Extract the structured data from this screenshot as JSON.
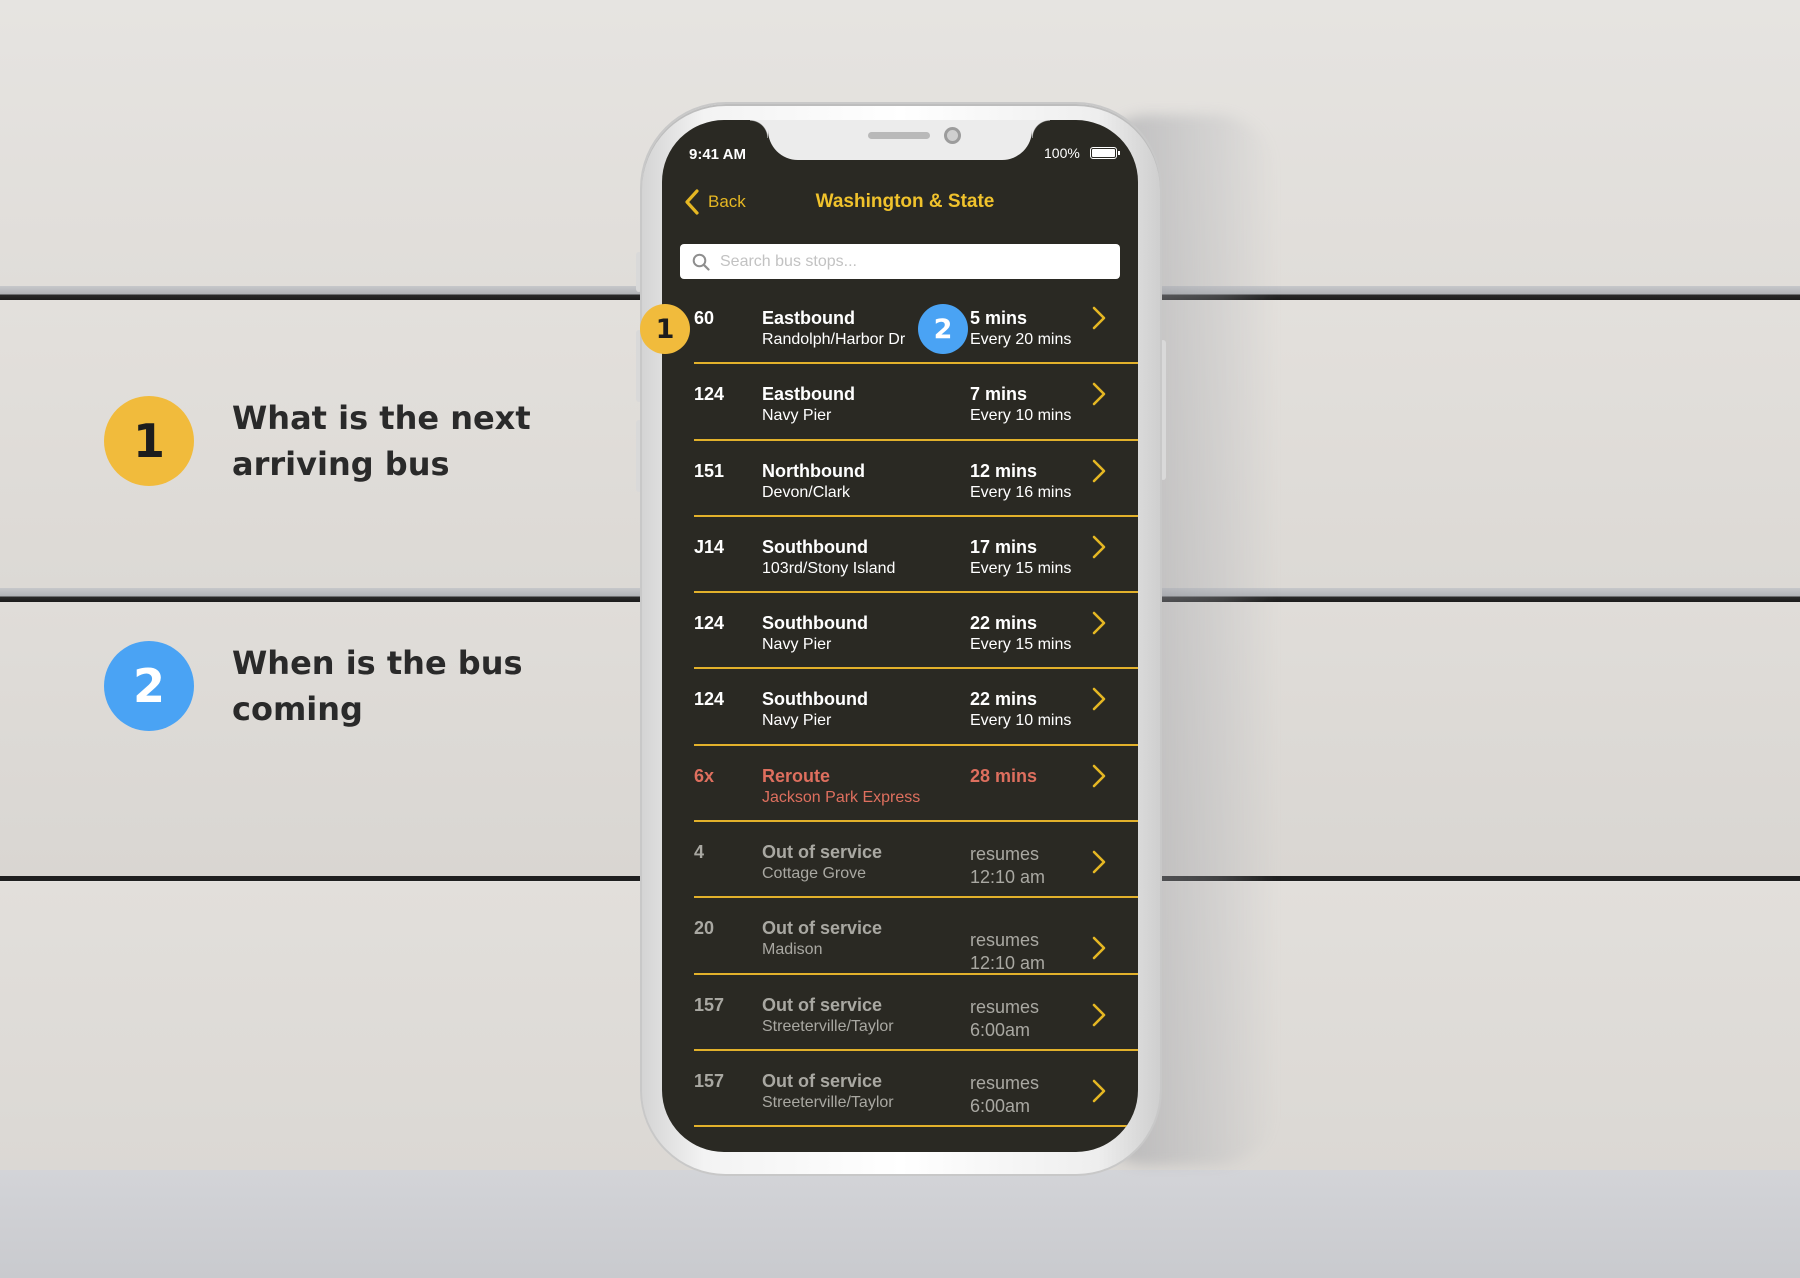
{
  "legend": [
    {
      "number": "1",
      "text": "What is the next arriving bus",
      "color": "#f1bb3c"
    },
    {
      "number": "2",
      "text": "When is the bus coming",
      "color": "#4aa3f4"
    }
  ],
  "markers": {
    "arrival": "1",
    "time": "2"
  },
  "status_bar": {
    "time": "9:41 AM",
    "battery": "100%"
  },
  "nav": {
    "back_label": "Back",
    "title": "Washington & State"
  },
  "search": {
    "placeholder": "Search bus stops..."
  },
  "routes": [
    {
      "route": "60",
      "direction": "Eastbound",
      "destination": "Randolph/Harbor Dr",
      "eta": "5 mins",
      "frequency": "Every 20 mins",
      "state": "normal"
    },
    {
      "route": "124",
      "direction": "Eastbound",
      "destination": "Navy Pier",
      "eta": "7 mins",
      "frequency": "Every 10 mins",
      "state": "normal"
    },
    {
      "route": "151",
      "direction": "Northbound",
      "destination": "Devon/Clark",
      "eta": "12 mins",
      "frequency": "Every 16 mins",
      "state": "normal"
    },
    {
      "route": "J14",
      "direction": "Southbound",
      "destination": "103rd/Stony Island",
      "eta": "17 mins",
      "frequency": "Every 15 mins",
      "state": "normal"
    },
    {
      "route": "124",
      "direction": "Southbound",
      "destination": "Navy Pier",
      "eta": "22 mins",
      "frequency": "Every 15 mins",
      "state": "normal"
    },
    {
      "route": "124",
      "direction": "Southbound",
      "destination": "Navy Pier",
      "eta": "22 mins",
      "frequency": "Every 10 mins",
      "state": "normal"
    },
    {
      "route": "6x",
      "direction": "Reroute",
      "destination": "Jackson Park Express",
      "eta": "28 mins",
      "frequency": "",
      "state": "reroute"
    },
    {
      "route": "4",
      "direction": "Out of service",
      "destination": "Cottage Grove",
      "eta": "resumes",
      "frequency": "12:10 am",
      "state": "out_of_service"
    },
    {
      "route": "20",
      "direction": "Out of service",
      "destination": "Madison",
      "eta": "resumes",
      "frequency": "12:10 am",
      "state": "out_of_service"
    },
    {
      "route": "157",
      "direction": "Out of service",
      "destination": "Streeterville/Taylor",
      "eta": "resumes",
      "frequency": "6:00am",
      "state": "out_of_service"
    },
    {
      "route": "157",
      "direction": "Out of service",
      "destination": "Streeterville/Taylor",
      "eta": "resumes",
      "frequency": "6:00am",
      "state": "out_of_service"
    }
  ],
  "colors": {
    "accent": "#f0c22c",
    "divider": "#e2b12b",
    "screen_background": "#2a2923",
    "reroute": "#de6f5e",
    "out_of_service": "#a9a8a2"
  },
  "icons": {
    "back": "chevron-left-icon",
    "search": "magnifier-icon",
    "row_action": "chevron-right-icon",
    "battery": "battery-icon"
  }
}
